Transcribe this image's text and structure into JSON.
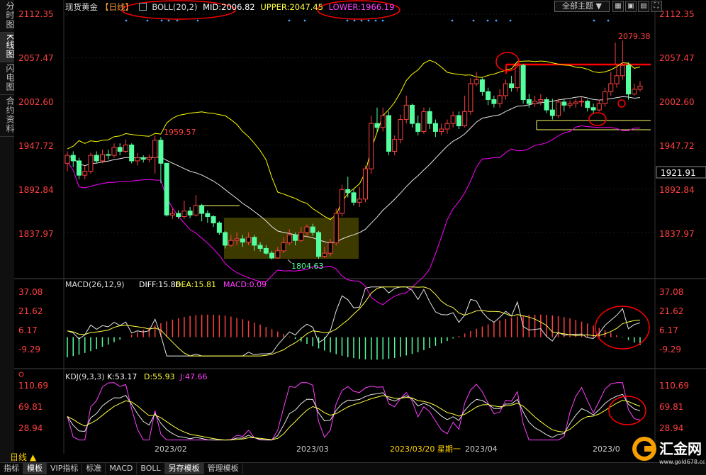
{
  "sidebar": [
    "分时图",
    "K线图",
    "闪电图",
    "合约资料"
  ],
  "header": {
    "symbol": "现货黄金",
    "period_tag": "【日线】",
    "boll": "BOLL(20,2)",
    "mid": "MID:2006.82",
    "upper": "UPPER:2047.45",
    "lower": "LOWER:1966.19",
    "theme_select": "全部主题 ▼"
  },
  "price_axis": [
    "2112.35",
    "2057.47",
    "2002.60",
    "1947.72",
    "1892.84",
    "1837.97"
  ],
  "current_price": "1921.91",
  "annotations": {
    "high_a": "1959.57",
    "low": "1804.63",
    "high_b": "2079.38"
  },
  "macd": {
    "title": "MACD(26,12,9)",
    "diff": "DIFF:15.86",
    "dea": "DEA:15.81",
    "macd": "MACD:0.09",
    "axis": [
      "37.08",
      "21.62",
      "6.17",
      "-9.29"
    ]
  },
  "kdj": {
    "title": "KDJ(9,3,3)",
    "k": "K:53.17",
    "d": "D:55.93",
    "j": "J:47.66",
    "axis": [
      "110.69",
      "69.81",
      "28.94"
    ]
  },
  "x_labels": [
    "2023/02",
    "2023/03",
    "2023/03/20 星期一",
    "2023/04",
    "2023/0"
  ],
  "period_label": "日线 ▲",
  "tabs": [
    "指标",
    "模板",
    "VIP指标",
    "标准",
    "MACD",
    "BOLL",
    "另存模板",
    "管理模板"
  ],
  "selected_tabs": [
    "模板",
    "另存模板"
  ],
  "logo": {
    "name": "汇金网",
    "url": "www.gold678.com"
  },
  "colors": {
    "up": "#ff4040",
    "down": "#54ffa0",
    "mid": "#e6e6e6",
    "upper": "#ffff00",
    "lower": "#ff00ff",
    "axis_red": "#ff4040",
    "yellow": "#ffd200",
    "circle": "#ff0000"
  },
  "chart_data": {
    "type": "candlestick",
    "candles": [
      [
        1925,
        1935,
        1940,
        1915
      ],
      [
        1935,
        1928,
        1940,
        1920
      ],
      [
        1928,
        1910,
        1932,
        1905
      ],
      [
        1910,
        1915,
        1922,
        1905
      ],
      [
        1915,
        1935,
        1938,
        1912
      ],
      [
        1935,
        1928,
        1940,
        1925
      ],
      [
        1928,
        1936,
        1942,
        1925
      ],
      [
        1936,
        1935,
        1942,
        1930
      ],
      [
        1935,
        1945,
        1950,
        1932
      ],
      [
        1945,
        1940,
        1950,
        1935
      ],
      [
        1940,
        1948,
        1955,
        1938
      ],
      [
        1948,
        1928,
        1950,
        1925
      ],
      [
        1928,
        1932,
        1938,
        1922
      ],
      [
        1932,
        1930,
        1935,
        1926
      ],
      [
        1930,
        1932,
        1936,
        1926
      ],
      [
        1932,
        1954,
        1960,
        1912
      ],
      [
        1954,
        1925,
        1958,
        1900
      ],
      [
        1925,
        1860,
        1925,
        1858
      ],
      [
        1860,
        1862,
        1868,
        1855
      ],
      [
        1862,
        1858,
        1866,
        1855
      ],
      [
        1858,
        1865,
        1878,
        1855
      ],
      [
        1865,
        1860,
        1870,
        1856
      ],
      [
        1860,
        1872,
        1885,
        1858
      ],
      [
        1872,
        1862,
        1874,
        1852
      ],
      [
        1862,
        1858,
        1866,
        1850
      ],
      [
        1858,
        1850,
        1860,
        1845
      ],
      [
        1850,
        1838,
        1852,
        1835
      ],
      [
        1838,
        1822,
        1840,
        1818
      ],
      [
        1822,
        1828,
        1835,
        1820
      ],
      [
        1828,
        1830,
        1838,
        1822
      ],
      [
        1830,
        1826,
        1835,
        1820
      ],
      [
        1826,
        1832,
        1838,
        1822
      ],
      [
        1832,
        1822,
        1835,
        1815
      ],
      [
        1822,
        1818,
        1826,
        1814
      ],
      [
        1818,
        1812,
        1822,
        1810
      ],
      [
        1812,
        1806,
        1815,
        1804
      ],
      [
        1806,
        1815,
        1820,
        1805
      ],
      [
        1815,
        1825,
        1832,
        1812
      ],
      [
        1825,
        1835,
        1842,
        1822
      ],
      [
        1835,
        1828,
        1838,
        1822
      ],
      [
        1828,
        1838,
        1845,
        1826
      ],
      [
        1838,
        1845,
        1848,
        1832
      ],
      [
        1845,
        1838,
        1849,
        1834
      ],
      [
        1838,
        1808,
        1840,
        1805
      ],
      [
        1808,
        1812,
        1820,
        1806
      ],
      [
        1812,
        1825,
        1830,
        1808
      ],
      [
        1825,
        1862,
        1868,
        1822
      ],
      [
        1862,
        1892,
        1898,
        1858
      ],
      [
        1892,
        1888,
        1908,
        1882
      ],
      [
        1888,
        1876,
        1892,
        1872
      ],
      [
        1876,
        1880,
        1895,
        1870
      ],
      [
        1880,
        1918,
        1922,
        1876
      ],
      [
        1918,
        1975,
        1985,
        1912
      ],
      [
        1975,
        1970,
        1995,
        1965
      ],
      [
        1970,
        1985,
        1995,
        1965
      ],
      [
        1985,
        1940,
        1990,
        1935
      ],
      [
        1940,
        1955,
        1960,
        1935
      ],
      [
        1955,
        1980,
        1986,
        1950
      ],
      [
        1980,
        1998,
        2010,
        1975
      ],
      [
        1998,
        1975,
        2000,
        1970
      ],
      [
        1975,
        1965,
        1985,
        1960
      ],
      [
        1965,
        1990,
        1995,
        1962
      ],
      [
        1990,
        1975,
        1995,
        1968
      ],
      [
        1975,
        1965,
        1980,
        1958
      ],
      [
        1965,
        1968,
        1975,
        1960
      ],
      [
        1968,
        1975,
        1980,
        1962
      ],
      [
        1975,
        1985,
        1990,
        1970
      ],
      [
        1985,
        1972,
        1990,
        1968
      ],
      [
        1972,
        1990,
        2010,
        1970
      ],
      [
        1990,
        2025,
        2032,
        1986
      ],
      [
        2025,
        2030,
        2040,
        2022
      ],
      [
        2030,
        2015,
        2032,
        2010
      ],
      [
        2015,
        2005,
        2020,
        1998
      ],
      [
        2005,
        2000,
        2010,
        1995
      ],
      [
        2000,
        2010,
        2018,
        1995
      ],
      [
        2010,
        2025,
        2030,
        2005
      ],
      [
        2025,
        2020,
        2035,
        2015
      ],
      [
        2020,
        2048,
        2052,
        2015
      ],
      [
        2048,
        2005,
        2050,
        2000
      ],
      [
        2005,
        2000,
        2012,
        1995
      ],
      [
        2000,
        2003,
        2010,
        1996
      ],
      [
        2003,
        2005,
        2012,
        1998
      ],
      [
        2005,
        1992,
        2008,
        1988
      ],
      [
        1992,
        1985,
        2006,
        1980
      ],
      [
        1985,
        2002,
        2006,
        1982
      ],
      [
        2002,
        1998,
        2006,
        1990
      ],
      [
        1998,
        2000,
        2004,
        1994
      ],
      [
        2000,
        2002,
        2006,
        1995
      ],
      [
        2002,
        2003,
        2008,
        1996
      ],
      [
        2003,
        1995,
        2005,
        1990
      ],
      [
        1995,
        1992,
        2000,
        1988
      ],
      [
        1992,
        2000,
        2005,
        1990
      ],
      [
        2000,
        2015,
        2020,
        1996
      ],
      [
        2015,
        2025,
        2040,
        2010
      ],
      [
        2025,
        2035,
        2050,
        2020
      ],
      [
        2035,
        2048,
        2079,
        2030
      ],
      [
        2048,
        2012,
        2052,
        2005
      ],
      [
        2012,
        2018,
        2025,
        2010
      ],
      [
        2018,
        2022,
        2028,
        2015
      ]
    ]
  }
}
